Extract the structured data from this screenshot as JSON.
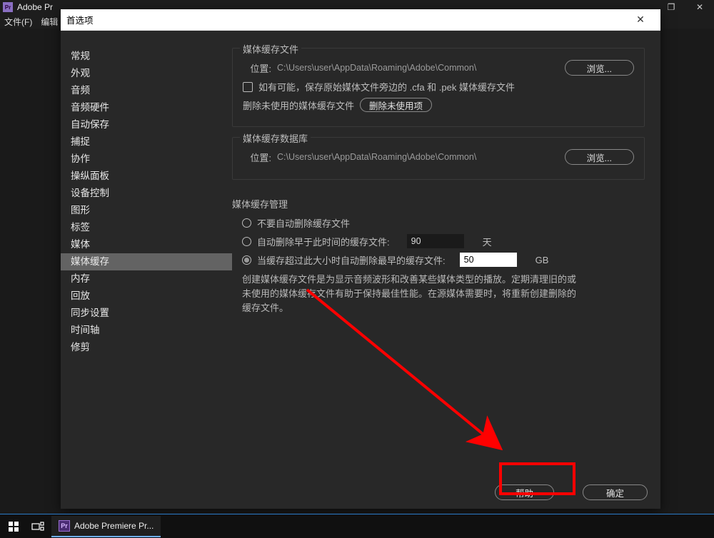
{
  "premiere": {
    "app_name": "Adobe Pr",
    "menu_file": "文件(F)",
    "menu_edit": "编辑"
  },
  "dialog": {
    "title": "首选项"
  },
  "sidebar": {
    "items": [
      "常规",
      "外观",
      "音频",
      "音频硬件",
      "自动保存",
      "捕捉",
      "协作",
      "操纵面板",
      "设备控制",
      "图形",
      "标签",
      "媒体",
      "媒体缓存",
      "内存",
      "回放",
      "同步设置",
      "时间轴",
      "修剪"
    ],
    "selected_index": 12
  },
  "s1": {
    "title": "媒体缓存文件",
    "loc_label": "位置:",
    "loc_path": "C:\\Users\\user\\AppData\\Roaming\\Adobe\\Common\\",
    "browse": "浏览...",
    "checkbox_label": "如有可能，保存原始媒体文件旁边的 .cfa 和 .pek 媒体缓存文件",
    "delete_label": "删除未使用的媒体缓存文件",
    "delete_btn": "删除未使用项"
  },
  "s2": {
    "title": "媒体缓存数据库",
    "loc_label": "位置:",
    "loc_path": "C:\\Users\\user\\AppData\\Roaming\\Adobe\\Common\\",
    "browse": "浏览..."
  },
  "s3": {
    "title": "媒体缓存管理",
    "opt1": "不要自动删除缓存文件",
    "opt2": "自动删除早于此时间的缓存文件:",
    "opt2_val": "90",
    "opt2_unit": "天",
    "opt3": "当缓存超过此大小时自动删除最早的缓存文件:",
    "opt3_val": "50",
    "opt3_unit": "GB",
    "desc": "创建媒体缓存文件是为显示音频波形和改善某些媒体类型的播放。定期清理旧的或未使用的媒体缓存文件有助于保持最佳性能。在源媒体需要时，将重新创建删除的缓存文件。"
  },
  "footer": {
    "help": "帮助",
    "ok": "确定"
  },
  "taskbar": {
    "task_label": "Adobe Premiere Pr..."
  }
}
